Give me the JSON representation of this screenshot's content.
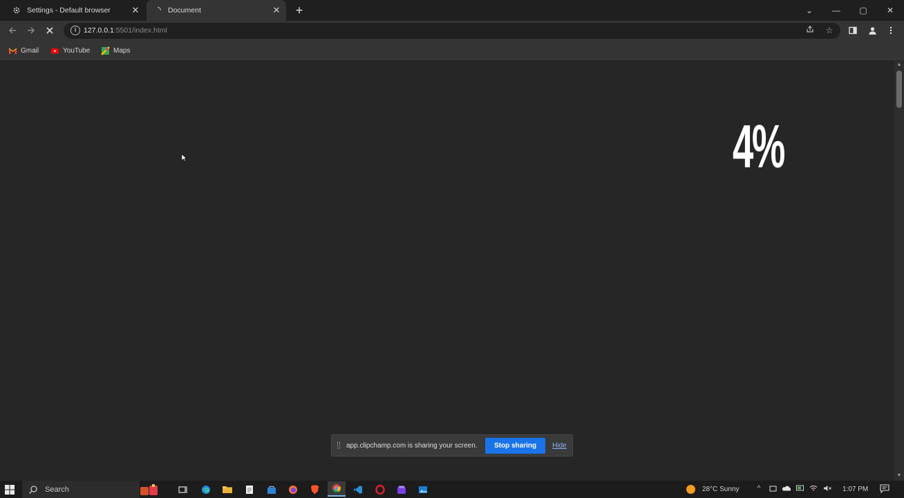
{
  "browser": {
    "tabs": [
      {
        "title": "Settings - Default browser",
        "active": false,
        "icon": "gear-icon"
      },
      {
        "title": "Document",
        "active": true,
        "icon": "loading-icon"
      }
    ],
    "window_controls": {
      "tab_search": "⌄",
      "minimize": "—",
      "maximize": "▢",
      "close": "✕"
    },
    "address": {
      "host": "127.0.0.1",
      "path": ":5501/index.html"
    },
    "bookmarks": [
      {
        "label": "Gmail",
        "icon": "gmail-icon"
      },
      {
        "label": "YouTube",
        "icon": "youtube-icon"
      },
      {
        "label": "Maps",
        "icon": "maps-icon"
      }
    ]
  },
  "page": {
    "loading_percent": "4%"
  },
  "share_bar": {
    "message": "app.clipchamp.com is sharing your screen.",
    "stop_label": "Stop sharing",
    "hide_label": "Hide"
  },
  "taskbar": {
    "search_placeholder": "Search",
    "weather": "28°C  Sunny",
    "time": "1:07 PM"
  },
  "colors": {
    "page_bg": "#262626",
    "accent_blue": "#1a73e8",
    "link_blue": "#8ab4f8"
  }
}
